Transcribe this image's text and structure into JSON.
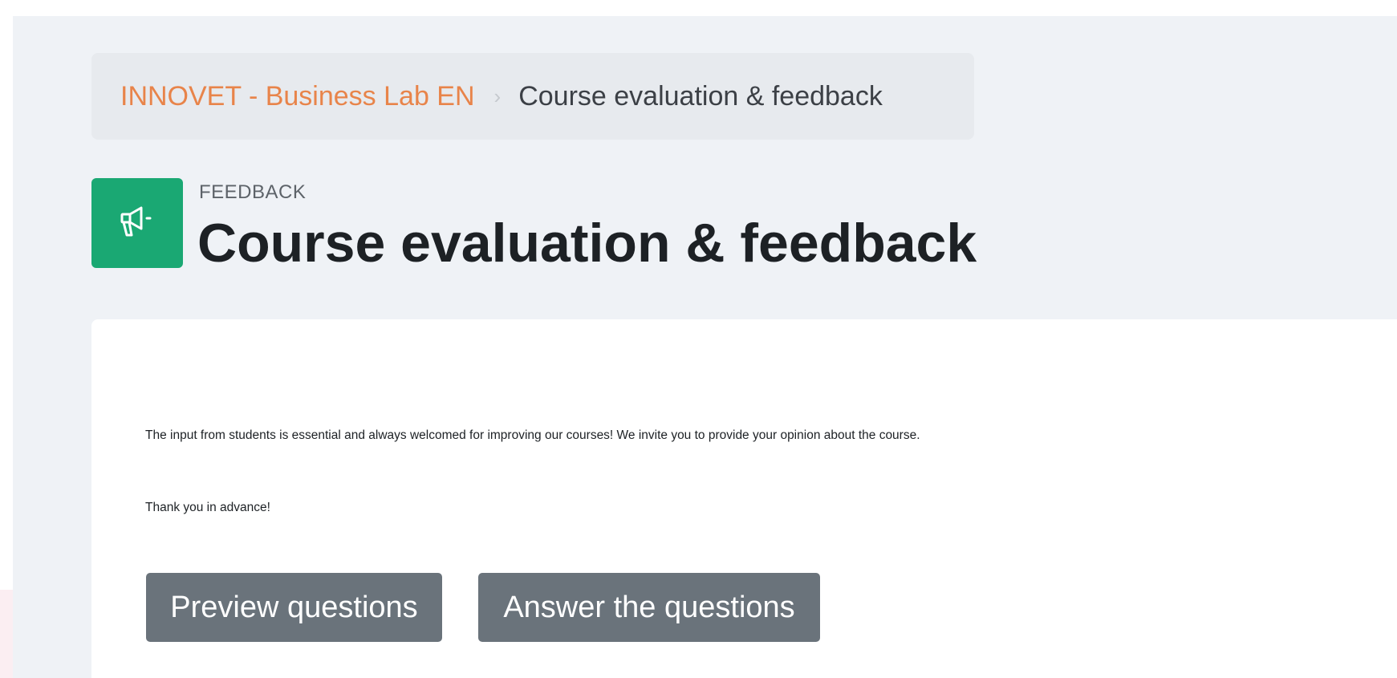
{
  "breadcrumb": {
    "course": "INNOVET - Business Lab EN",
    "separator": "›",
    "current": "Course evaluation & feedback"
  },
  "header": {
    "icon": "megaphone-icon",
    "module_type": "FEEDBACK",
    "title": "Course evaluation & feedback"
  },
  "content": {
    "intro": "The input from students is essential and always welcomed for improving our courses! We invite you to provide your opinion about the course.",
    "thanks": "Thank you in advance!"
  },
  "actions": {
    "preview_label": "Preview questions",
    "answer_label": "Answer the questions"
  },
  "colors": {
    "accent": "#e8844a",
    "icon_bg": "#1aa873",
    "button_bg": "#6a737b",
    "page_bg": "#eff2f6"
  }
}
